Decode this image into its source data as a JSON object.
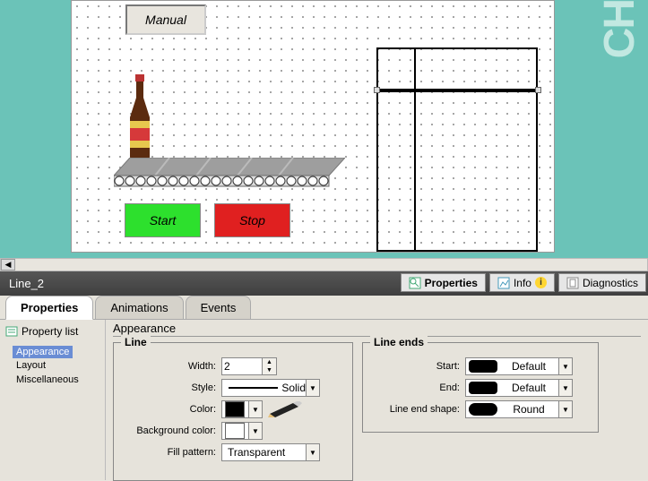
{
  "canvas": {
    "manual": "Manual",
    "start": "Start",
    "stop": "Stop",
    "right_text": "CH"
  },
  "object_name": "Line_2",
  "header_tabs": {
    "properties": "Properties",
    "info": "Info",
    "diagnostics": "Diagnostics"
  },
  "panel_tabs": {
    "properties": "Properties",
    "animations": "Animations",
    "events": "Events"
  },
  "sidebar": {
    "property_list": "Property list",
    "items": [
      "Appearance",
      "Layout",
      "Miscellaneous"
    ]
  },
  "section_title": "Appearance",
  "line_group": {
    "title": "Line",
    "width_label": "Width:",
    "width_value": "2",
    "style_label": "Style:",
    "style_value": "Solid",
    "color_label": "Color:",
    "bgcolor_label": "Background color:",
    "fill_label": "Fill pattern:",
    "fill_value": "Transparent",
    "color_hex": "#000000",
    "bgcolor_hex": "#ffffff"
  },
  "lineends_group": {
    "title": "Line ends",
    "start_label": "Start:",
    "start_value": "Default",
    "end_label": "End:",
    "end_value": "Default",
    "shape_label": "Line end shape:",
    "shape_value": "Round"
  }
}
